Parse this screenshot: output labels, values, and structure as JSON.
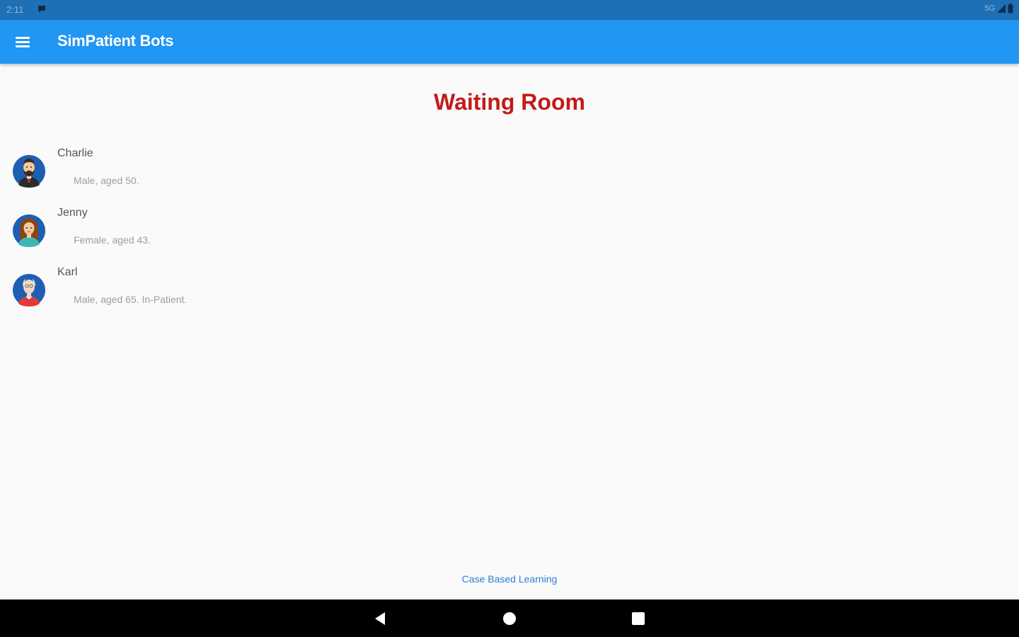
{
  "status_bar": {
    "time": "2:11",
    "network": "5G",
    "notification_icon": "chat-bubble-icon",
    "signal_icon": "signal-icon",
    "battery_icon": "battery-icon"
  },
  "app_bar": {
    "title": "SimPatient Bots",
    "menu_icon": "hamburger-menu-icon",
    "background": "#2196f3"
  },
  "main": {
    "title": "Waiting Room",
    "title_color": "#c41a1a",
    "patients": [
      {
        "name": "Charlie",
        "description": "Male, aged 50.",
        "avatar_icon": "bearded-man-avatar-icon"
      },
      {
        "name": "Jenny",
        "description": "Female, aged 43.",
        "avatar_icon": "woman-avatar-icon"
      },
      {
        "name": "Karl",
        "description": "Male, aged 65. In-Patient.",
        "avatar_icon": "elderly-man-avatar-icon"
      }
    ]
  },
  "footer": {
    "link_label": "Case Based Learning"
  },
  "nav_bar": {
    "back_icon": "back-triangle-icon",
    "home_icon": "home-circle-icon",
    "recents_icon": "recents-square-icon"
  }
}
